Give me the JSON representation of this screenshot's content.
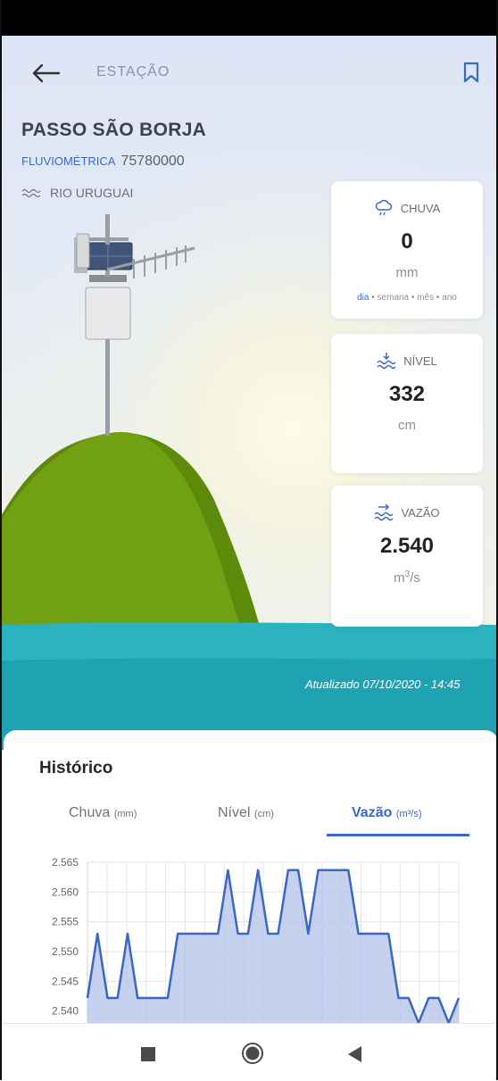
{
  "header": {
    "station_label": "ESTAÇÃO"
  },
  "station": {
    "name": "PASSO SÃO BORJA",
    "type": "FLUVIOMÉTRICA",
    "code": "75780000",
    "river": "RIO URUGUAI"
  },
  "cards": {
    "rain": {
      "label": "CHUVA",
      "value": "0",
      "unit": "mm",
      "periods": {
        "day": "dia",
        "week": "semana",
        "month": "mês",
        "year": "ano",
        "sep": "•",
        "active": "dia"
      }
    },
    "level": {
      "label": "NÍVEL",
      "value": "332",
      "unit": "cm"
    },
    "flow": {
      "label": "VAZÃO",
      "value": "2.540",
      "unit_base": "m",
      "unit_sup": "3",
      "unit_tail": "/s"
    }
  },
  "updated": "Atualizado 07/10/2020 - 14:45",
  "history": {
    "title": "Histórico",
    "tabs": [
      {
        "label": "Chuva",
        "unit": "(mm)"
      },
      {
        "label": "Nível",
        "unit": "(cm)"
      },
      {
        "label": "Vazão",
        "unit": "(m³/s)",
        "active": true
      }
    ]
  },
  "colors": {
    "accent": "#3b68c6",
    "chart_fill": "#b3c2ea",
    "hill": "#6f9a12",
    "water": "#22aab7"
  },
  "icons": {
    "back": "arrow-left-icon",
    "bookmark": "bookmark-icon",
    "river": "waves-icon",
    "rain": "cloud-rain-icon",
    "level": "water-level-icon",
    "flow": "water-flow-icon"
  },
  "chart_data": {
    "type": "area",
    "series": [
      {
        "values": [
          2.5422,
          2.553,
          2.5422,
          2.5422,
          2.553,
          2.5422,
          2.5422,
          2.5422,
          2.5422,
          2.553,
          2.553,
          2.553,
          2.553,
          2.553,
          2.5637,
          2.553,
          2.553,
          2.5637,
          2.553,
          2.553,
          2.5637,
          2.5637,
          2.553,
          2.5637,
          2.5637,
          2.5637,
          2.5637,
          2.553,
          2.553,
          2.553,
          2.553,
          2.5422,
          2.5422,
          2.538,
          2.5422,
          2.5422,
          2.538,
          2.5422
        ]
      }
    ],
    "y_ticks": [
      "2.565",
      "2.560",
      "2.555",
      "2.550",
      "2.545",
      "2.540"
    ],
    "ylim": [
      2.538,
      2.565
    ],
    "grid": true
  }
}
